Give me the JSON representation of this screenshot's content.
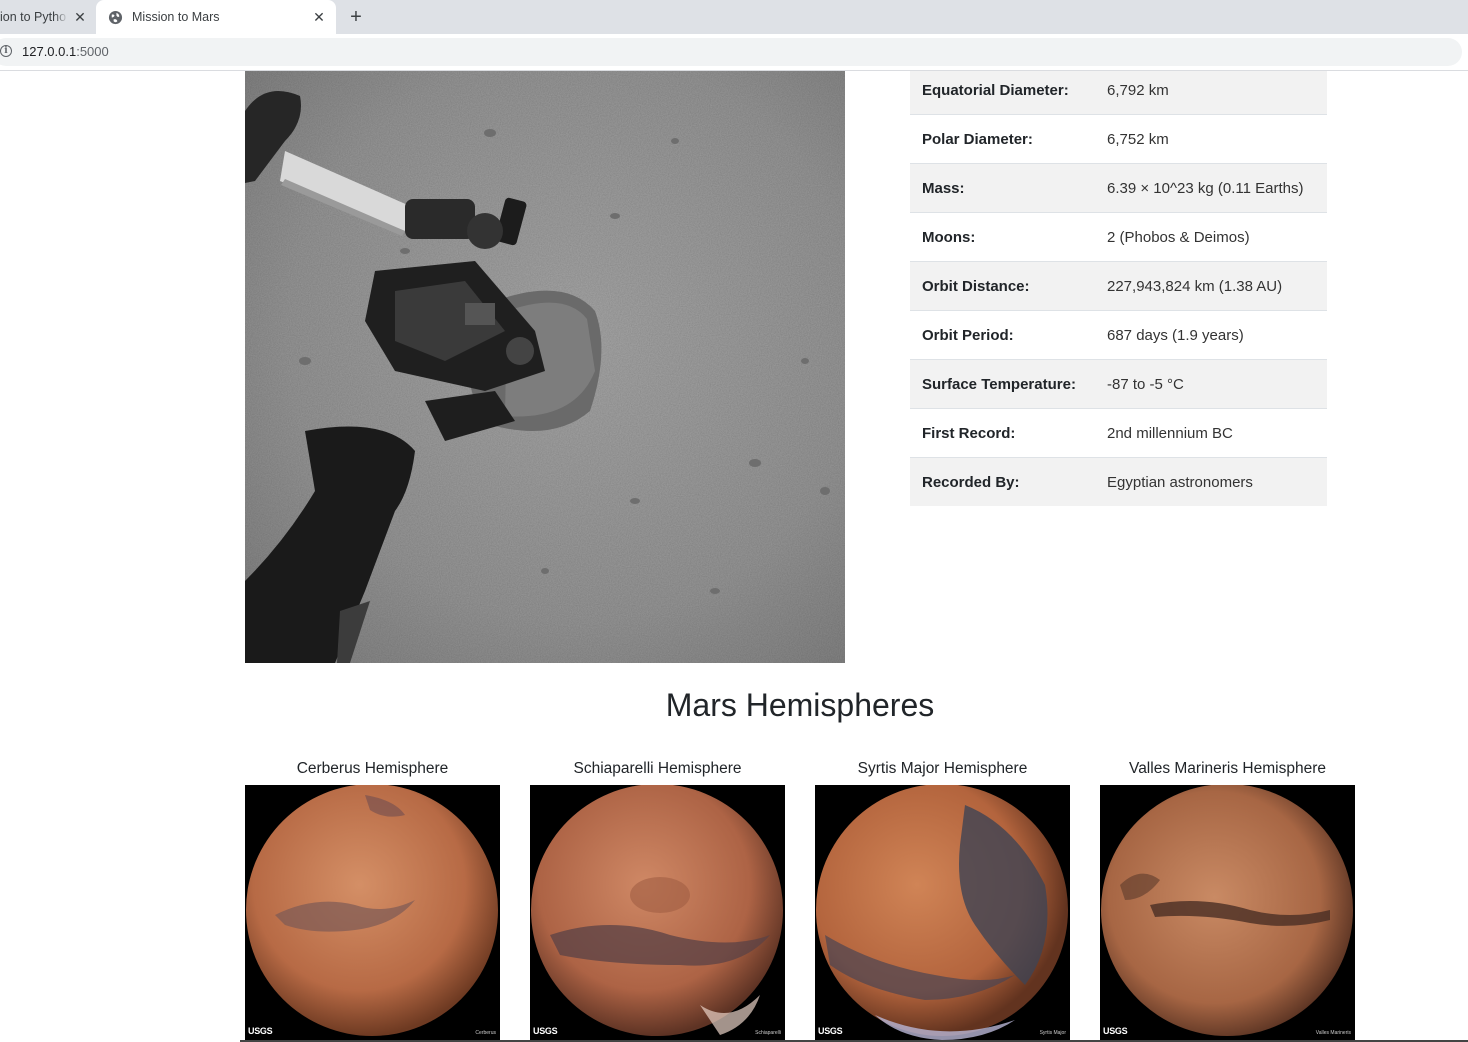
{
  "browser": {
    "tabs": [
      {
        "title": "ion to Pytho",
        "active": false
      },
      {
        "title": "Mission to Mars",
        "active": true
      }
    ],
    "url_host": "127.0.0.1",
    "url_port": ":5000"
  },
  "facts": [
    {
      "label": "Equatorial Diameter:",
      "value": "6,792 km"
    },
    {
      "label": "Polar Diameter:",
      "value": "6,752 km"
    },
    {
      "label": "Mass:",
      "value": "6.39 × 10^23 kg (0.11 Earths)"
    },
    {
      "label": "Moons:",
      "value": "2 (Phobos & Deimos)"
    },
    {
      "label": "Orbit Distance:",
      "value": "227,943,824 km (1.38 AU)"
    },
    {
      "label": "Orbit Period:",
      "value": "687 days (1.9 years)"
    },
    {
      "label": "Surface Temperature:",
      "value": "-87 to -5 °C"
    },
    {
      "label": "First Record:",
      "value": "2nd millennium BC"
    },
    {
      "label": "Recorded By:",
      "value": "Egyptian astronomers"
    }
  ],
  "hemispheres_title": "Mars Hemispheres",
  "hemispheres": [
    {
      "title": "Cerberus Hemisphere",
      "caption": "Cerberus"
    },
    {
      "title": "Schiaparelli Hemisphere",
      "caption": "Schiaparelli"
    },
    {
      "title": "Syrtis Major Hemisphere",
      "caption": "Syrtis Major"
    },
    {
      "title": "Valles Marineris Hemisphere",
      "caption": "Valles Marineris"
    }
  ],
  "usgs_label": "USGS"
}
